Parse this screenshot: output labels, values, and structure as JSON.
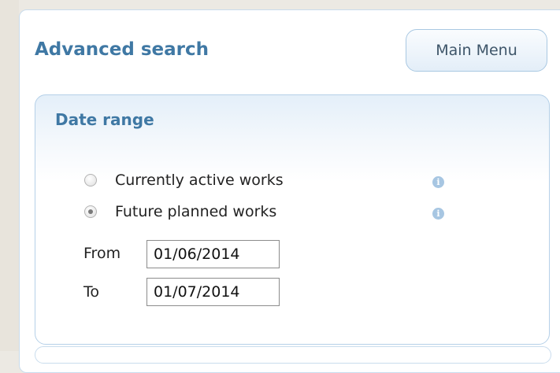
{
  "header": {
    "title": "Advanced search",
    "main_menu_label": "Main Menu"
  },
  "date_range": {
    "title": "Date range",
    "options": [
      {
        "label": "Currently active works",
        "selected": false,
        "info_icon": "info-icon"
      },
      {
        "label": "Future planned works",
        "selected": true,
        "info_icon": "info-icon"
      }
    ],
    "from_label": "From",
    "from_value": "01/06/2014",
    "to_label": "To",
    "to_value": "01/07/2014"
  },
  "colors": {
    "accent": "#3f78a4",
    "info_icon": "#a7c6e2",
    "panel_border": "#b5d0e8"
  }
}
